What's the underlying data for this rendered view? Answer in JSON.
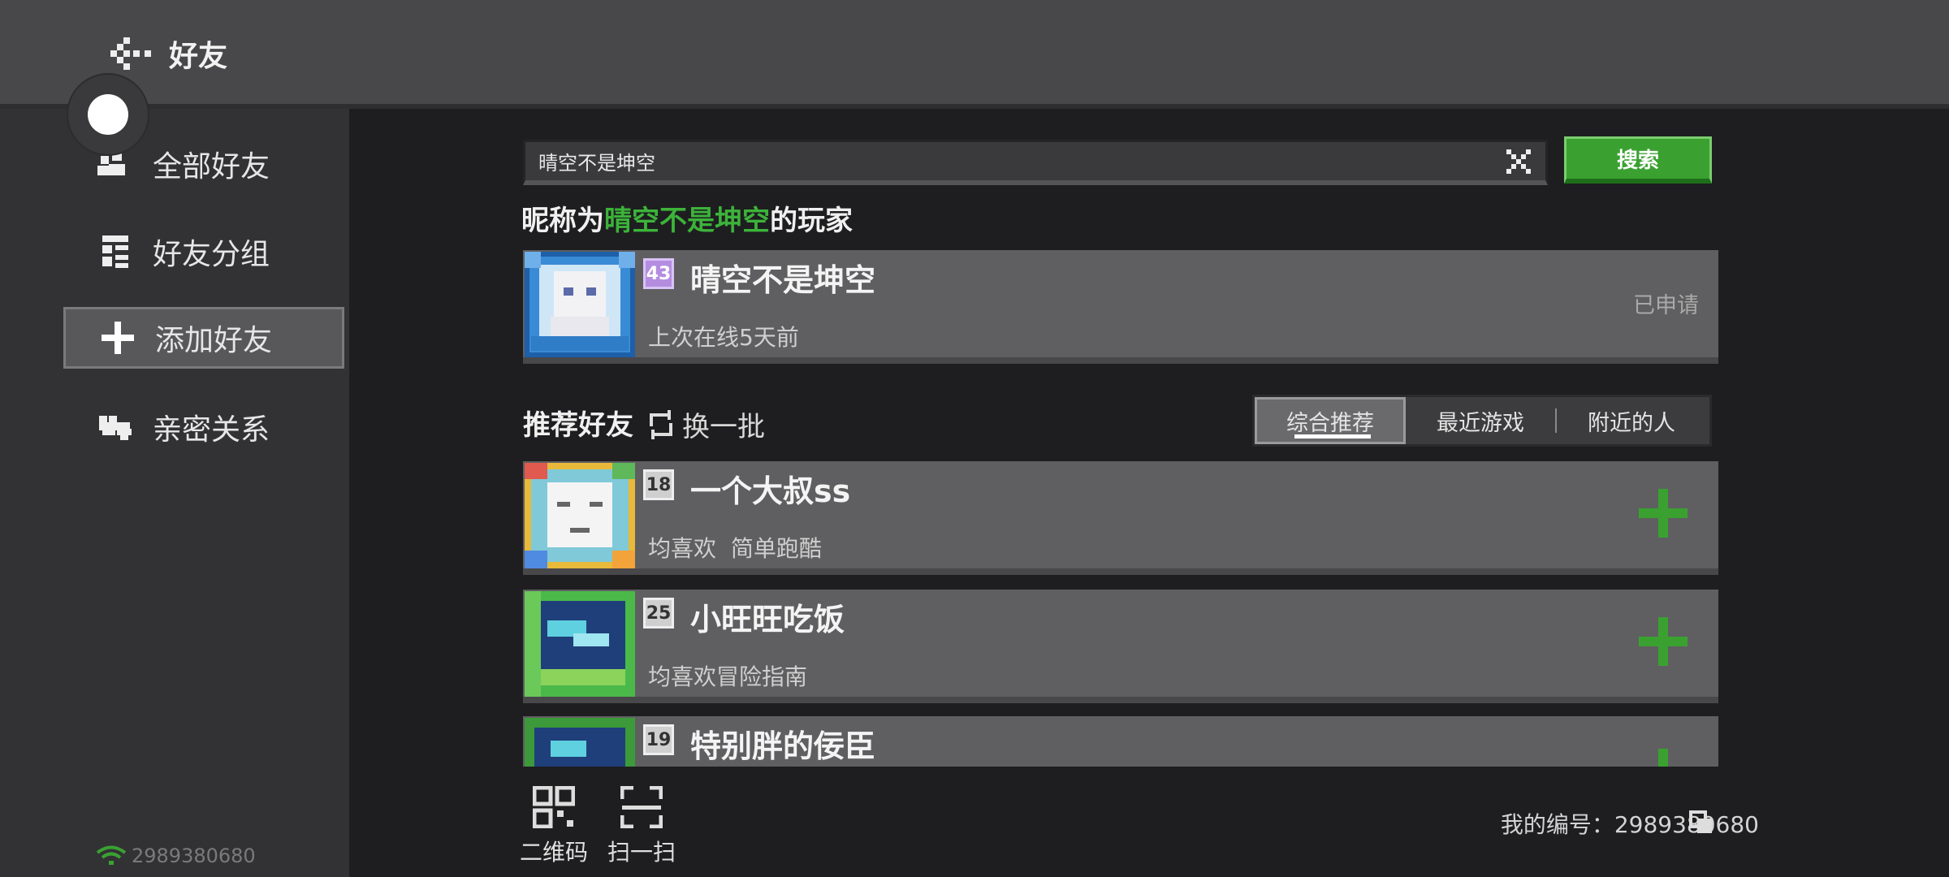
{
  "header": {
    "title": "好友",
    "back_icon": "back-arrow-icon"
  },
  "sidebar": {
    "items": [
      {
        "label": "全部好友",
        "icon": "friends-icon"
      },
      {
        "label": "好友分组",
        "icon": "group-icon"
      },
      {
        "label": "添加好友",
        "icon": "plus-icon",
        "active": true
      },
      {
        "label": "亲密关系",
        "icon": "hearts-icon"
      }
    ],
    "connection_id": "2989380680"
  },
  "search": {
    "value": "晴空不是坤空",
    "button_label": "搜索"
  },
  "result": {
    "caption_prefix": "昵称为",
    "caption_highlight": "晴空不是坤空",
    "caption_suffix": "的玩家",
    "player": {
      "level": "43",
      "name": "晴空不是坤空",
      "last_online": "上次在线5天前",
      "status": "已申请"
    }
  },
  "recommend": {
    "title": "推荐好友",
    "refresh_label": "换一批",
    "tabs": [
      "综合推荐",
      "最近游戏",
      "附近的人"
    ],
    "active_tab": 0,
    "players": [
      {
        "level": "18",
        "name": "一个大叔ss",
        "tags": [
          "均喜欢",
          "简单跑酷"
        ]
      },
      {
        "level": "25",
        "name": "小旺旺吃饭",
        "tags": [
          "均喜欢冒险指南"
        ]
      },
      {
        "level": "19",
        "name": "特别胖的佞臣",
        "tags": []
      }
    ]
  },
  "footer": {
    "qr_label": "二维码",
    "scan_label": "扫一扫",
    "my_id_label": "我的编号：2989380680"
  },
  "colors": {
    "accent_green": "#3aa131",
    "highlight_green": "#3cb33a",
    "badge_purple": "#b48de0"
  }
}
